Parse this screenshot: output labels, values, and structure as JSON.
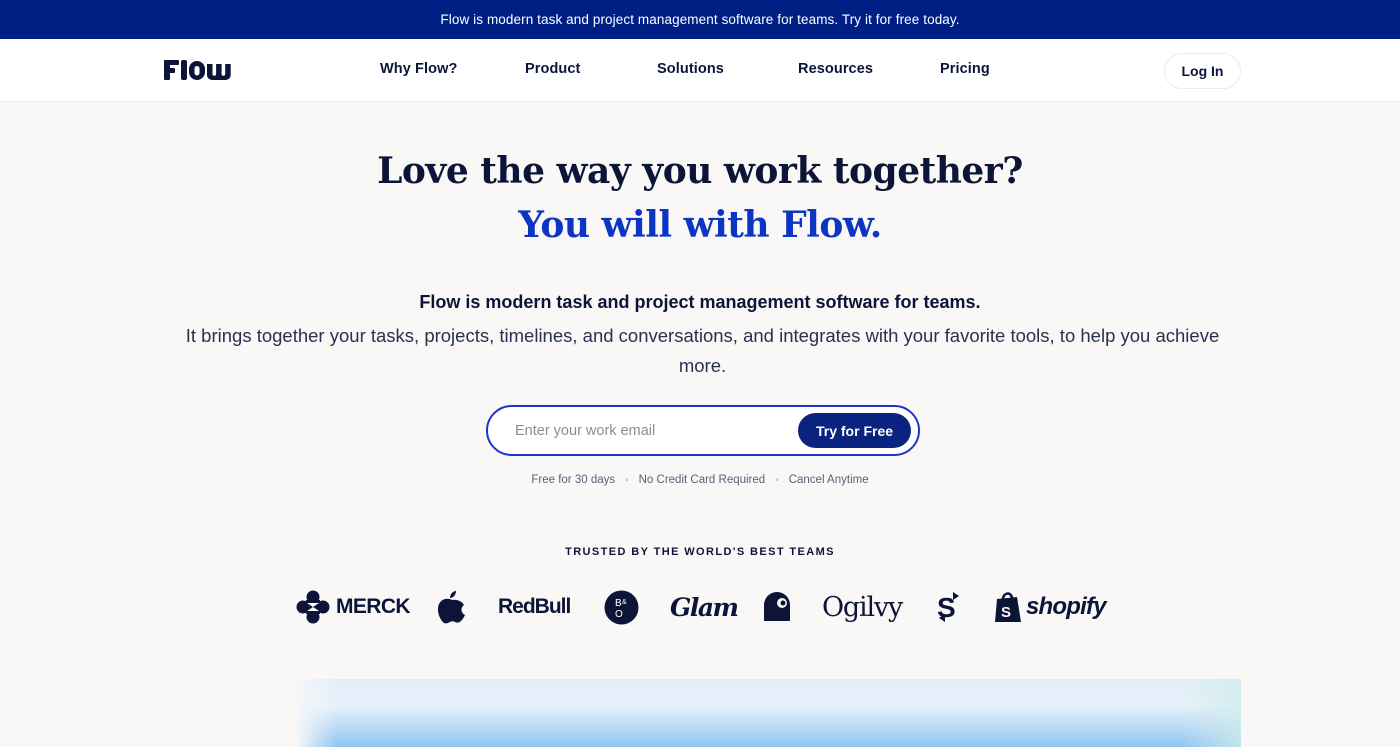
{
  "banner": {
    "text": "Flow is modern task and project management software for teams. Try it for free today."
  },
  "header": {
    "logo_text": "Flow",
    "nav": [
      {
        "label": "Why Flow?"
      },
      {
        "label": "Product"
      },
      {
        "label": "Solutions"
      },
      {
        "label": "Resources"
      },
      {
        "label": "Pricing"
      }
    ],
    "login_label": "Log In"
  },
  "hero": {
    "title": "Love the way you work together?",
    "subtitle": "You will with Flow.",
    "description_strong": "Flow is modern task and project management software for teams.",
    "description": "It brings together your tasks, projects, timelines, and conversations, and integrates with your favorite tools, to help you achieve more."
  },
  "signup": {
    "email_placeholder": "Enter your work email",
    "email_value": "",
    "cta_label": "Try for Free",
    "perks": [
      "Free for 30 days",
      "No Credit Card Required",
      "Cancel Anytime"
    ],
    "perk_separator": "•"
  },
  "trusted": {
    "heading": "TRUSTED BY THE WORLD'S BEST TEAMS",
    "brands": [
      {
        "name": "MERCK",
        "icon": "merck-logo"
      },
      {
        "name": "Apple",
        "icon": "apple-logo"
      },
      {
        "name": "RedBull",
        "icon": "redbull-logo"
      },
      {
        "name": "B&O",
        "icon": "bang-olufsen-logo"
      },
      {
        "name": "Glam",
        "icon": "glam-logo"
      },
      {
        "name": "Carhartt",
        "icon": "carhartt-logo"
      },
      {
        "name": "Ogilvy",
        "icon": "ogilvy-logo"
      },
      {
        "name": "Square Cash",
        "icon": "cash-app-logo"
      },
      {
        "name": "shopify",
        "icon": "shopify-logo"
      }
    ]
  },
  "colors": {
    "banner_bg": "#001f85",
    "primary_dark": "#0c1538",
    "accent_blue": "#0d35c4",
    "cta_bg": "#0a237f",
    "page_bg": "#f9f8f7"
  }
}
